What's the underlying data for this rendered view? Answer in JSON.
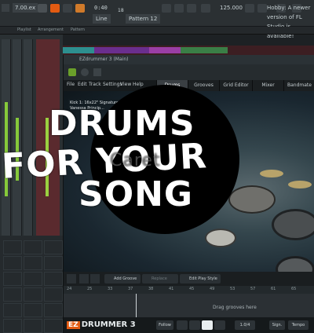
{
  "topbar": {
    "version": "7.00.ex",
    "tempo": "0:40",
    "tempo_sub": "18",
    "pattern": "Pattern 12",
    "line": "Line",
    "bpm": "125.000",
    "hint_text": "Hobby: A newer version of FL Studio is available!"
  },
  "row2": {
    "items": [
      "Playlist",
      "Arrangement",
      "Pattern"
    ]
  },
  "plugin": {
    "title": "EZdrummer 3 (Main)",
    "menu": [
      "File",
      "Edit",
      "Track",
      "Settings",
      "View",
      "Help"
    ],
    "tabs": [
      "Drums",
      "Grooves",
      "Grid Editor",
      "Mixer",
      "Bandmate"
    ],
    "kit_info_line1": "Kick 1: 16x22\" Signature",
    "kit_info_line2": "Vanessa Princip..."
  },
  "bottom_tools": {
    "add_groove": "Add Groove",
    "replace_with": "Replace With...",
    "edit_play_style": "Edit Play Style"
  },
  "ruler": [
    "24",
    "25",
    "33",
    "37",
    "38",
    "41",
    "45",
    "49",
    "53",
    "57",
    "61",
    "65"
  ],
  "drop_lane_text": "Drag grooves here",
  "footer": {
    "logo_ez": "EZ",
    "logo_text": "DRUMMER 3",
    "follow": "Follow",
    "tempo_value": "1.0/4",
    "sign": "Sign.",
    "tempo_label": "Tempo"
  },
  "overlay": {
    "line1": "DRUMS",
    "line2": "FOR YOUR",
    "line3": "SONG",
    "watermark": "Caret"
  },
  "colors": {
    "accent_orange": "#e35b12",
    "meter_green": "#86c93a",
    "overlay_disc": "#000000"
  }
}
